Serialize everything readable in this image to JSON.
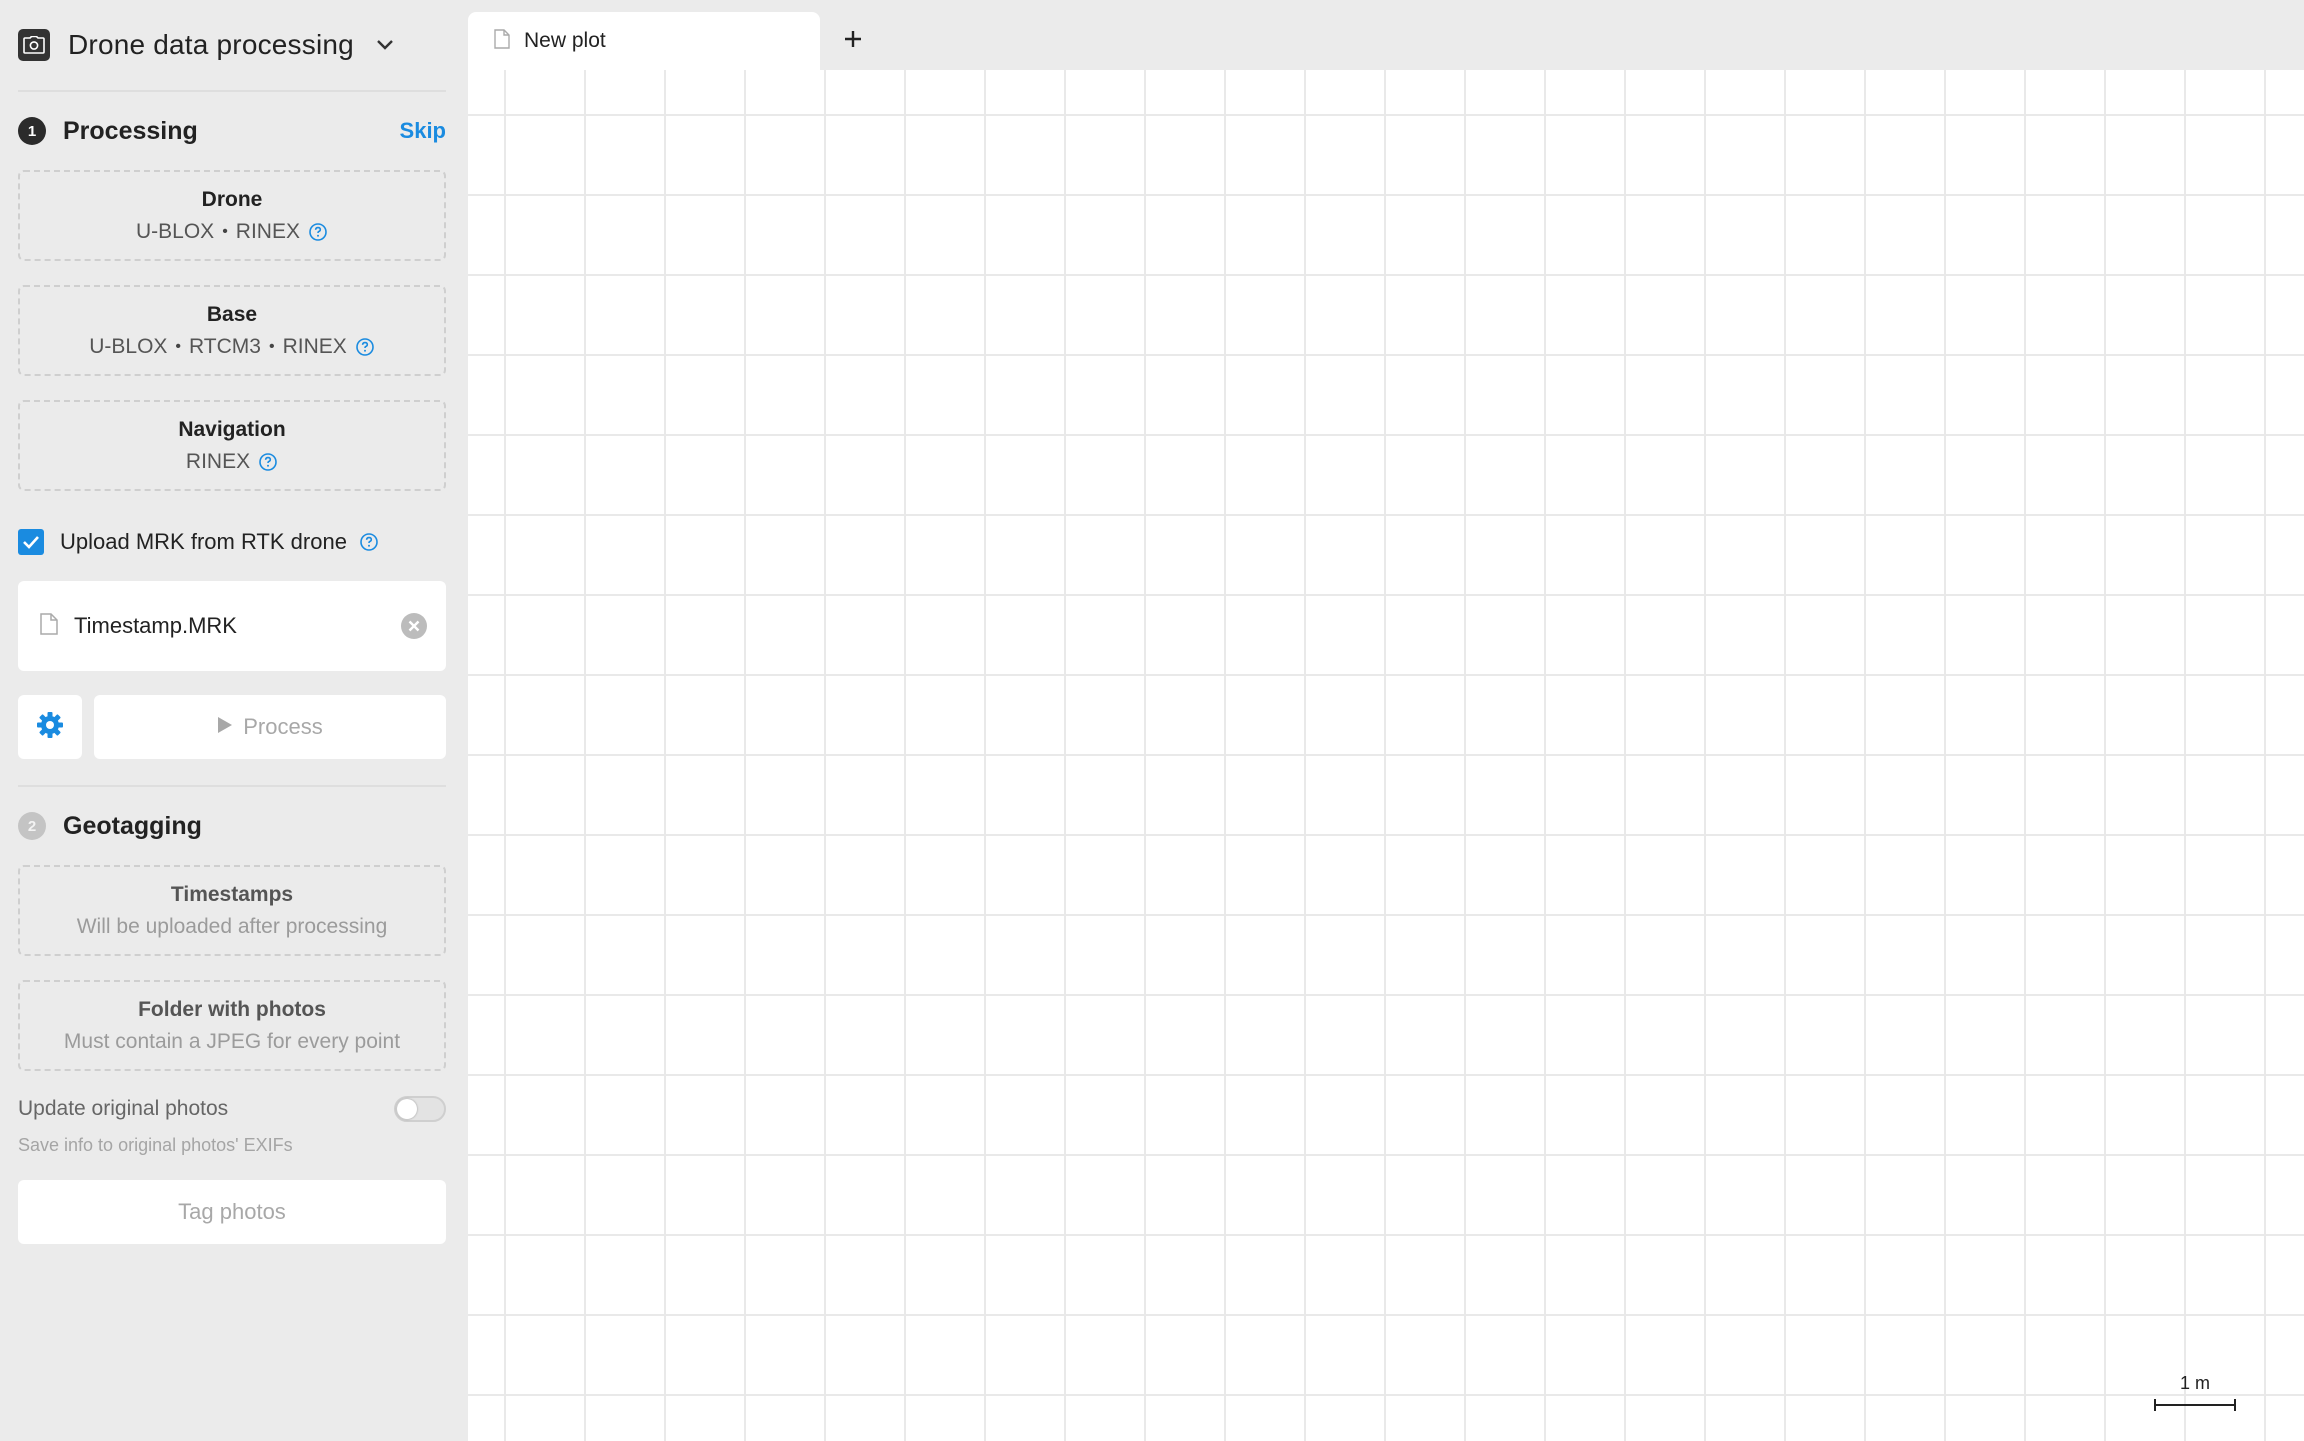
{
  "app": {
    "title": "Drone data processing"
  },
  "processing": {
    "step": "1",
    "title": "Processing",
    "skip_label": "Skip",
    "drone": {
      "title": "Drone",
      "formats": [
        "U-BLOX",
        "RINEX"
      ]
    },
    "base": {
      "title": "Base",
      "formats": [
        "U-BLOX",
        "RTCM3",
        "RINEX"
      ]
    },
    "navigation": {
      "title": "Navigation",
      "formats": [
        "RINEX"
      ]
    },
    "upload_mrk": {
      "label": "Upload MRK from RTK drone",
      "checked": true
    },
    "file": {
      "name": "Timestamp.MRK"
    },
    "process_label": "Process"
  },
  "geotagging": {
    "step": "2",
    "title": "Geotagging",
    "timestamps": {
      "title": "Timestamps",
      "subtitle": "Will be uploaded after processing"
    },
    "folder": {
      "title": "Folder with photos",
      "subtitle": "Must contain a JPEG for every point"
    },
    "update_photos": {
      "label": "Update original photos",
      "hint": "Save info to original photos' EXIFs",
      "enabled": false
    },
    "tag_label": "Tag photos"
  },
  "tabs": [
    {
      "label": "New plot",
      "active": true
    }
  ],
  "canvas": {
    "scale_label": "1 m"
  },
  "colors": {
    "accent": "#1a8be0",
    "sidebar_bg": "#ebebeb",
    "canvas_bg": "#ffffff",
    "grid": "#e9e9e9"
  }
}
